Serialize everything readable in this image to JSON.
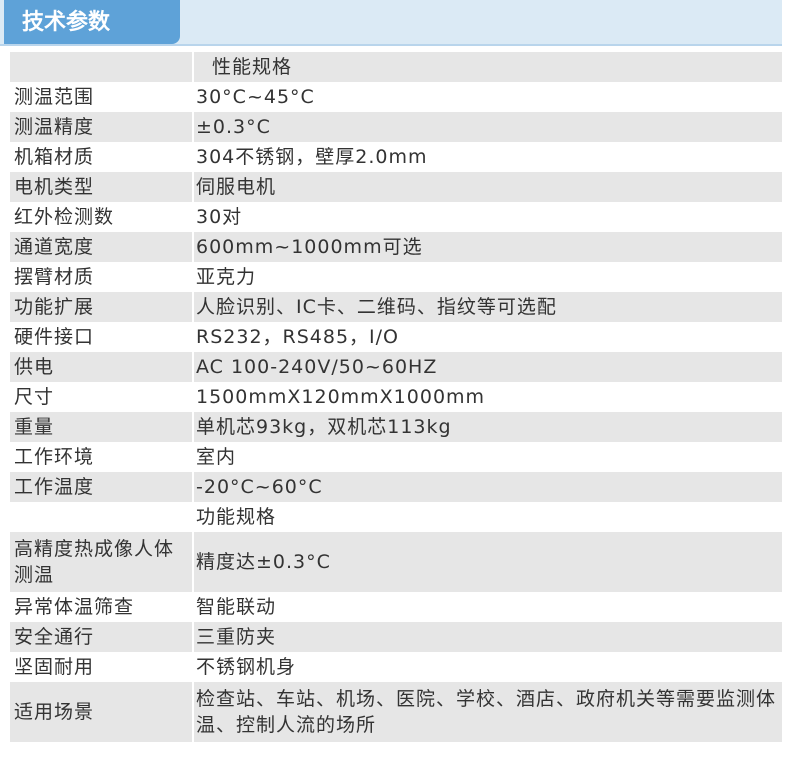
{
  "header": {
    "title": "技术参数"
  },
  "sections": [
    {
      "label": "",
      "value": "性能规格"
    },
    {
      "label": "测温范围",
      "value": "30°C~45°C"
    },
    {
      "label": "测温精度",
      "value": "±0.3°C"
    },
    {
      "label": "机箱材质",
      "value": "304不锈钢，壁厚2.0mm"
    },
    {
      "label": "电机类型",
      "value": "伺服电机"
    },
    {
      "label": "红外检测数",
      "value": "30对"
    },
    {
      "label": "通道宽度",
      "value": "600mm~1000mm可选"
    },
    {
      "label": "摆臂材质",
      "value": "亚克力"
    },
    {
      "label": "功能扩展",
      "value": "人脸识别、IC卡、二维码、指纹等可选配"
    },
    {
      "label": "硬件接口",
      "value": "RS232，RS485，I/O"
    },
    {
      "label": "供电",
      "value": "AC 100-240V/50~60HZ"
    },
    {
      "label": "尺寸",
      "value": "1500mmX120mmX1000mm"
    },
    {
      "label": "重量",
      "value": "单机芯93kg，双机芯113kg"
    },
    {
      "label": "工作环境",
      "value": "室内"
    },
    {
      "label": "工作温度",
      "value": "-20°C~60°C"
    },
    {
      "label": "",
      "value": "功能规格"
    },
    {
      "label": "高精度热成像人体测温",
      "value": "精度达±0.3°C"
    },
    {
      "label": "异常体温筛查",
      "value": "智能联动"
    },
    {
      "label": "安全通行",
      "value": "三重防夹"
    },
    {
      "label": "坚固耐用",
      "value": "不锈钢机身"
    },
    {
      "label": "适用场景",
      "value": "检查站、车站、机场、医院、学校、酒店、政府机关等需要监测体温、控制人流的场所"
    }
  ]
}
